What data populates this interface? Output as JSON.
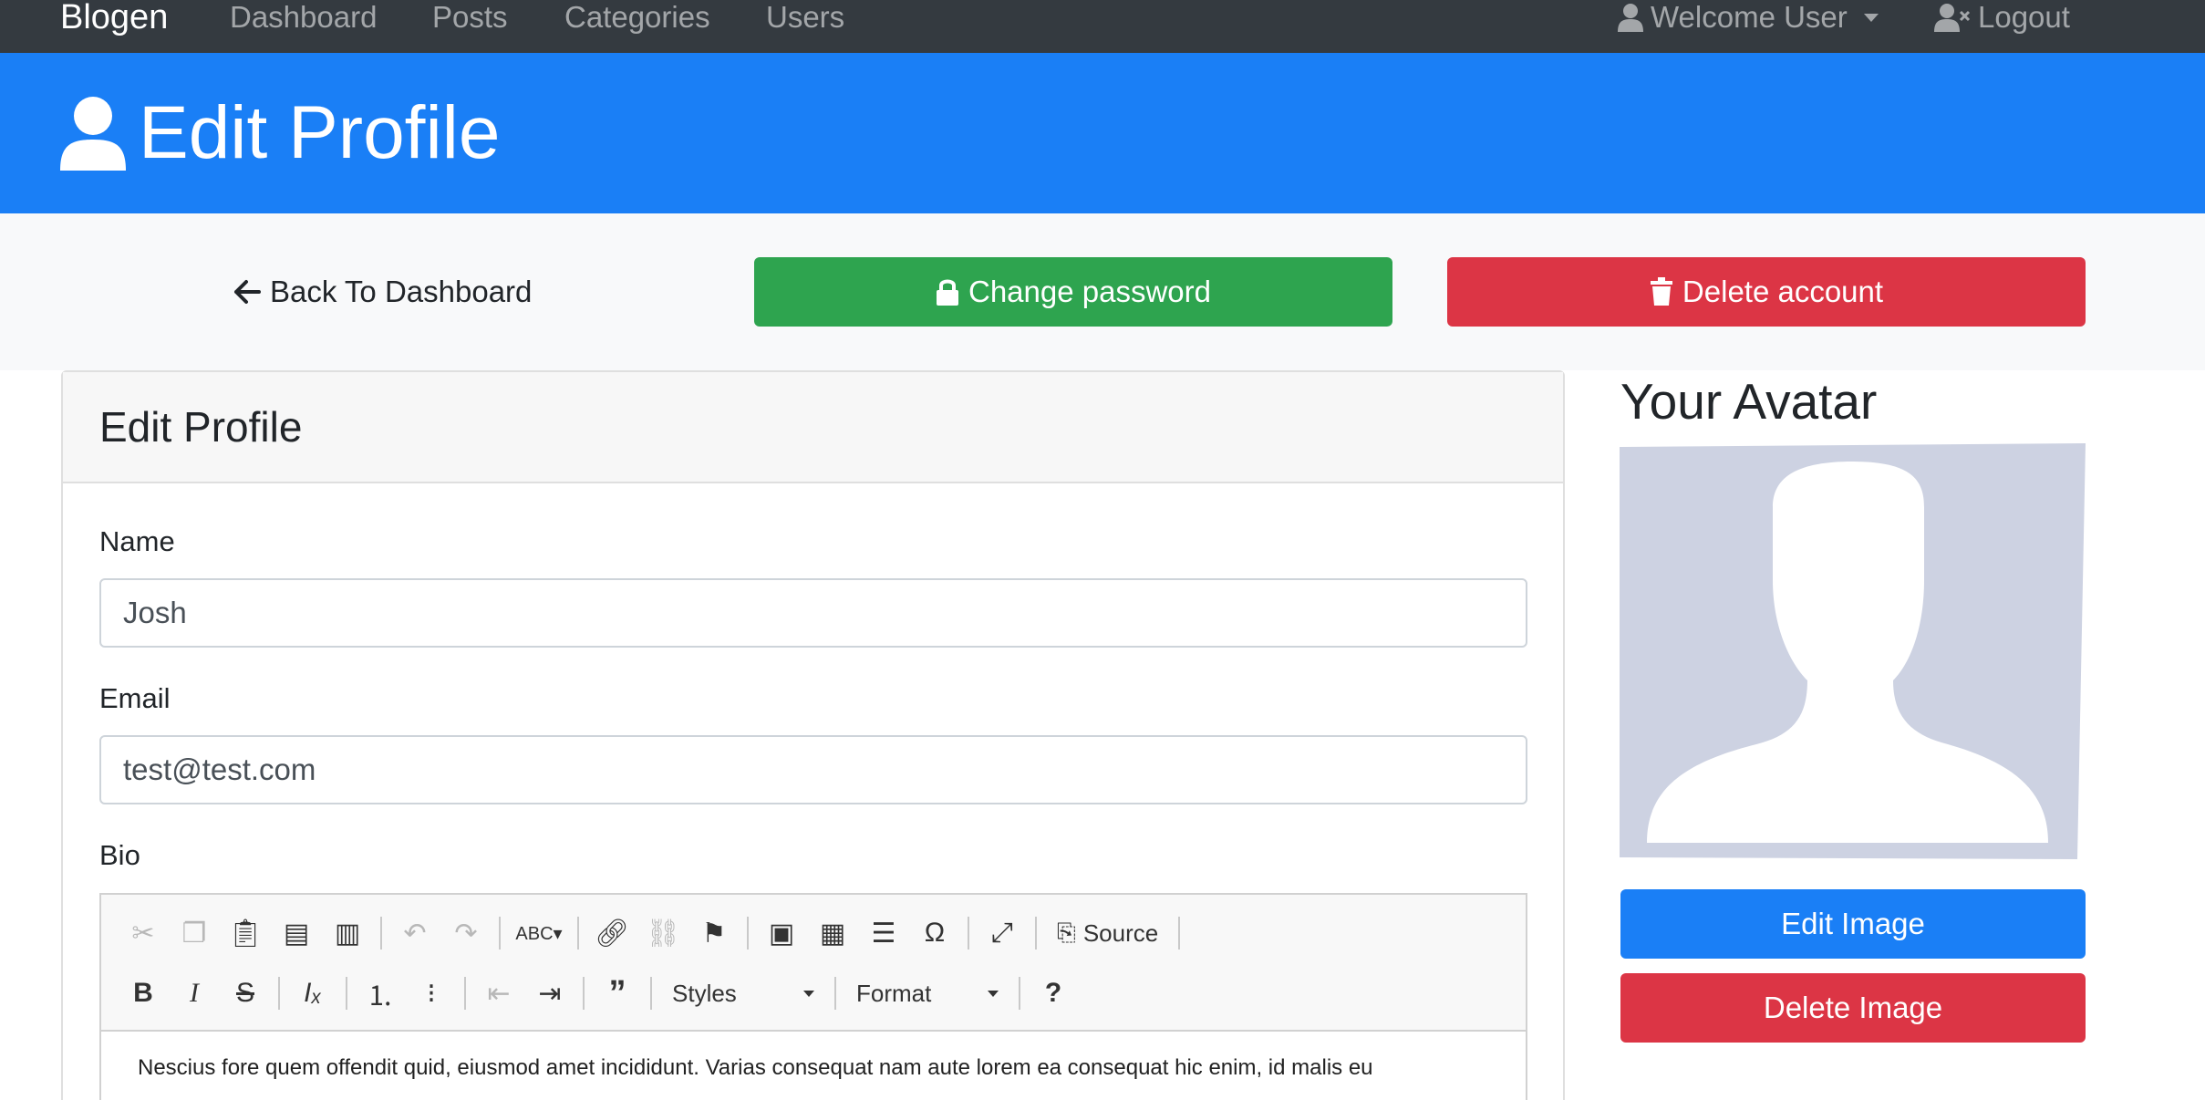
{
  "navbar": {
    "brand": "Blogen",
    "links": [
      "Dashboard",
      "Posts",
      "Categories",
      "Users"
    ],
    "welcome": "Welcome User",
    "logout": "Logout"
  },
  "header": {
    "title": "Edit Profile"
  },
  "actions": {
    "back": "Back To Dashboard",
    "change_password": "Change password",
    "delete_account": "Delete account"
  },
  "card": {
    "title": "Edit Profile",
    "name_label": "Name",
    "name_value": "Josh",
    "email_label": "Email",
    "email_value": "test@test.com",
    "bio_label": "Bio",
    "toolbar": {
      "source": "Source",
      "styles": "Styles",
      "format": "Format"
    },
    "bio_text": "Nescius fore quem offendit quid, eiusmod amet incididunt. Varias consequat nam aute lorem ea consequat hic enim, id malis eu"
  },
  "avatar": {
    "title": "Your Avatar",
    "edit_image": "Edit Image",
    "delete_image": "Delete Image"
  },
  "colors": {
    "primary": "#1a7ff6",
    "success": "#2ea44f",
    "danger": "#dc3545",
    "navbar": "#343a40",
    "avatar_bg": "#cdd2e2"
  }
}
